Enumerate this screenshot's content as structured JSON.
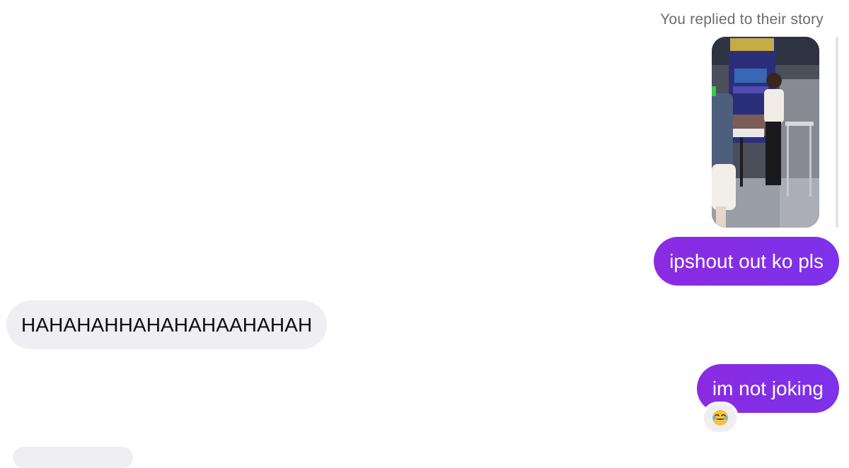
{
  "story_reply": {
    "caption": "You replied to their story"
  },
  "messages": [
    {
      "direction": "outgoing",
      "text": "ipshout out ko pls"
    },
    {
      "direction": "incoming",
      "text": "HAHAHAHHAHAHAHAAHAHAH"
    },
    {
      "direction": "outgoing",
      "text": "im not joking",
      "reaction": "😂"
    }
  ],
  "colors": {
    "outgoing_bubble": "#8a2be2",
    "incoming_bubble": "#eeeef3",
    "caption_text": "#6b6b70"
  }
}
